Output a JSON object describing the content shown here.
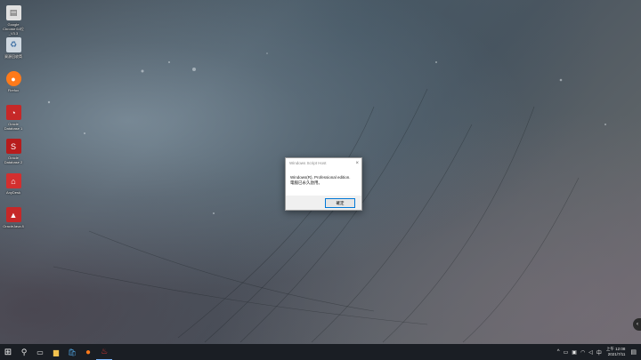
{
  "desktop": {
    "icons": [
      {
        "label": "Google Chrome 64位_V3.3",
        "icon": "document-icon",
        "color": "#e0e0e0"
      },
      {
        "label": "資源回收筒",
        "icon": "recycle-bin-icon",
        "color": "#cfd8e0"
      },
      {
        "label": "Firefox",
        "icon": "firefox-icon",
        "color": "#ff7a1a"
      },
      {
        "label": "Oracle Database 1",
        "icon": "oracle-icon",
        "color": "#c62828"
      },
      {
        "label": "Oracle Database 2",
        "icon": "oracle-icon",
        "color": "#b71c1c"
      },
      {
        "label": "AnyDesk",
        "icon": "home-icon",
        "color": "#d32f2f"
      },
      {
        "label": "OracleJava 8",
        "icon": "java-icon",
        "color": "#c62828"
      }
    ]
  },
  "dialog": {
    "title": "Windows Script Host",
    "close_glyph": "×",
    "message_line1": "Windows(R), Professional edition.",
    "message_line2": "電腦已永久啟用。",
    "ok_label": "確定"
  },
  "taskbar": {
    "start_glyph": "⊞",
    "search_glyph": "⚲",
    "taskview_glyph": "▭",
    "apps": [
      {
        "name": "file-explorer",
        "glyph": "▆",
        "color": "#f2c14e"
      },
      {
        "name": "microsoft-store",
        "glyph": "🛍",
        "color": "#4fa3e0"
      },
      {
        "name": "firefox",
        "glyph": "●",
        "color": "#ff7a1a"
      },
      {
        "name": "java-app",
        "glyph": "♨",
        "color": "#d32f2f"
      }
    ],
    "tray": {
      "chevron": "^",
      "time": "上午 12:08",
      "date": "2021/7/11",
      "language": "中",
      "notification_glyph": "▤"
    }
  },
  "side_handle": {
    "glyph": "‹"
  }
}
